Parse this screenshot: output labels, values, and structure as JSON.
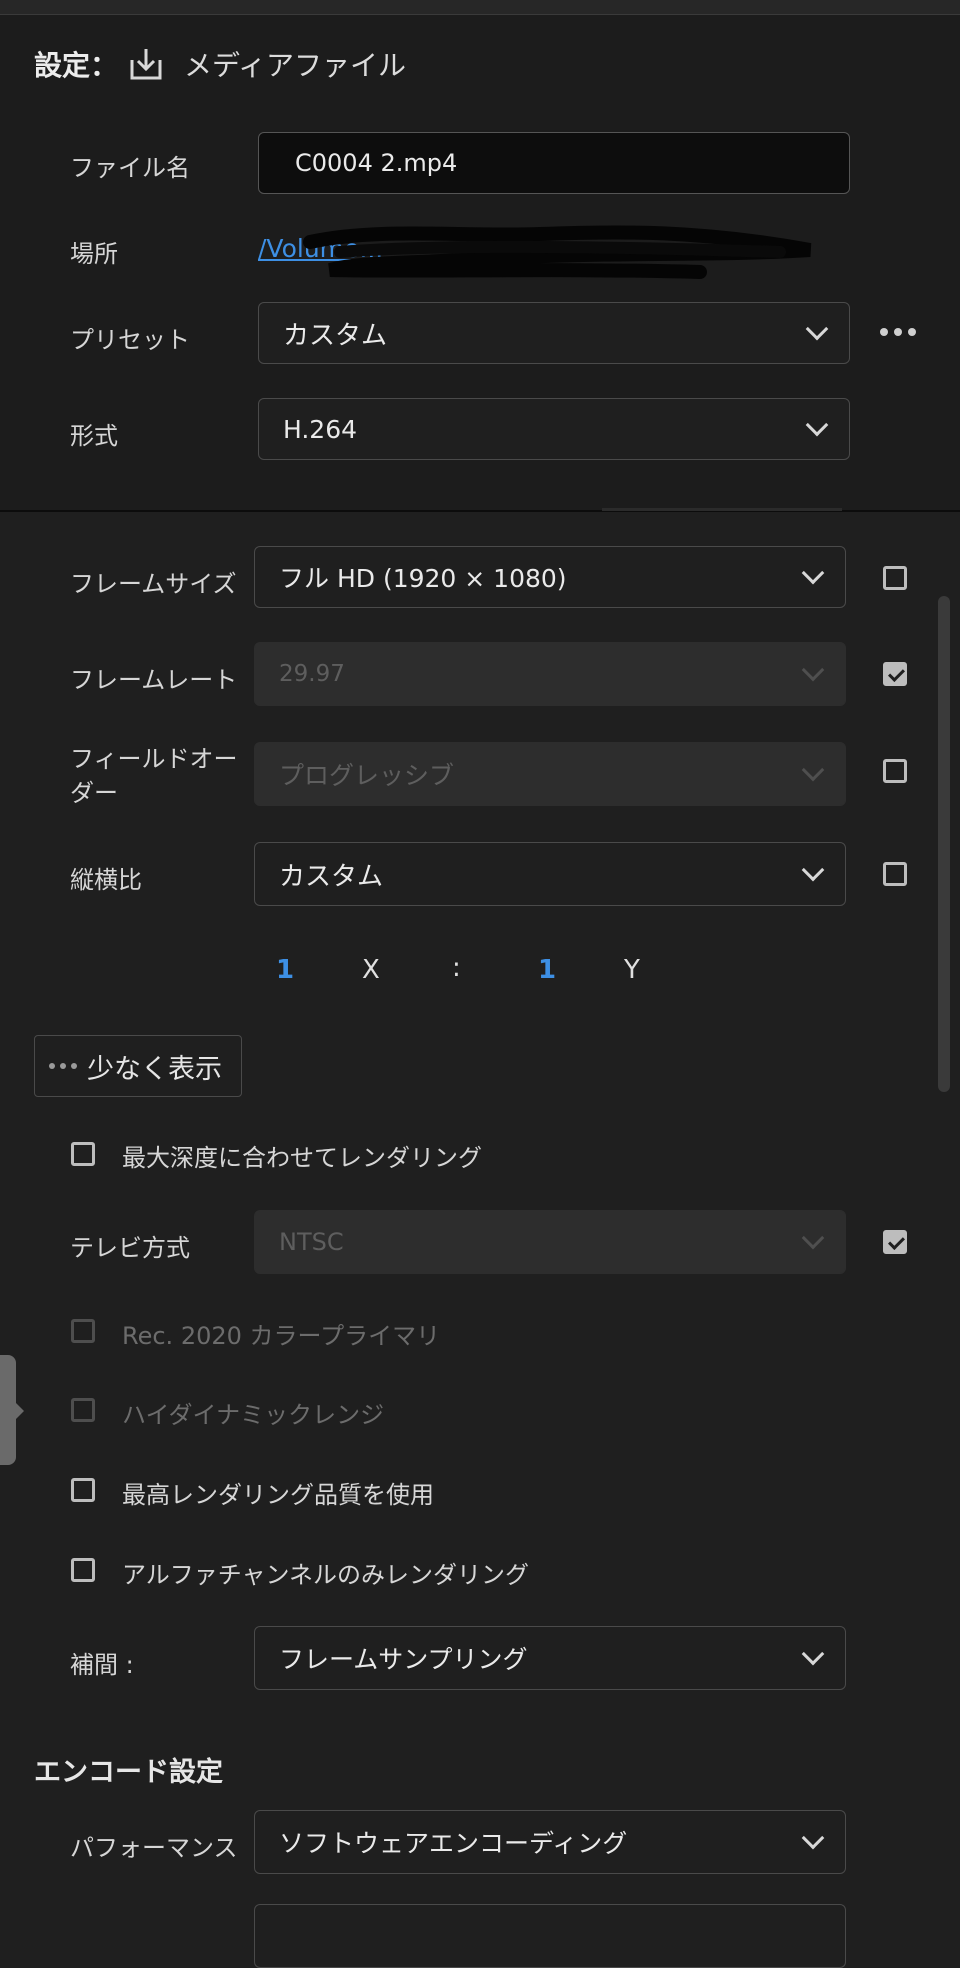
{
  "header": {
    "title": "設定：",
    "title_label": "メディアファイル",
    "title_icon": "download-icon"
  },
  "fields": {
    "filename_label": "ファイル名",
    "filename_value": "C0004 2.mp4",
    "location_label": "場所",
    "location_value": "/Volume...",
    "preset_label": "プリセット",
    "preset_value": "カスタム",
    "format_label": "形式",
    "format_value": "H.264"
  },
  "video": {
    "frame_size_label": "フレームサイズ",
    "frame_size_value": "フル HD (1920 × 1080)",
    "frame_size_checked": false,
    "frame_rate_label": "フレームレート",
    "frame_rate_value": "29.97",
    "frame_rate_checked": true,
    "field_order_label_1": "フィールドオー",
    "field_order_label_2": "ダー",
    "field_order_value": "プログレッシブ",
    "field_order_checked": false,
    "aspect_label": "縦横比",
    "aspect_value": "カスタム",
    "aspect_checked": false,
    "ratio_x_value": "1",
    "ratio_x_label": "X",
    "ratio_sep": ":",
    "ratio_y_value": "1",
    "ratio_y_label": "Y",
    "show_less": "少なく表示",
    "max_depth_label": "最大深度に合わせてレンダリング",
    "tv_label": "テレビ方式",
    "tv_value": "NTSC",
    "tv_checked": true,
    "rec2020_label": "Rec. 2020 カラープライマリ",
    "hdr_label": "ハイダイナミックレンジ",
    "max_quality_label": "最高レンダリング品質を使用",
    "alpha_label": "アルファチャンネルのみレンダリング",
    "interp_label": "補間 :",
    "interp_value": "フレームサンプリング"
  },
  "encode": {
    "section_title": "エンコード設定",
    "performance_label": "パフォーマンス",
    "performance_value": "ソフトウェアエンコーディング"
  },
  "colors": {
    "accent": "#3d8fe4",
    "background": "#1f1f1f",
    "panel": "#1c1c1c"
  }
}
